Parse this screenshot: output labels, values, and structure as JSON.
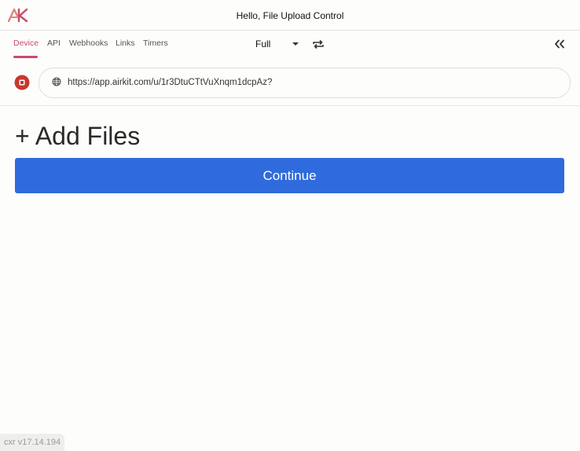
{
  "header": {
    "title": "Hello, File Upload Control",
    "logo_icon": "ak-logo-icon",
    "brand_colors": [
      "#d98a7a",
      "#c94a6e"
    ]
  },
  "toolbar": {
    "tabs": [
      {
        "label": "Device",
        "active": true
      },
      {
        "label": "API",
        "active": false
      },
      {
        "label": "Webhooks",
        "active": false
      },
      {
        "label": "Links",
        "active": false
      },
      {
        "label": "Timers",
        "active": false
      }
    ],
    "mode": "Full",
    "mode_caret_icon": "caret-down-icon",
    "repeat_icon": "repeat-icon",
    "collapse_icon": "double-chevron-left-icon",
    "active_color": "#c94a6e"
  },
  "address_bar": {
    "stop_icon": "stop-icon",
    "globe_icon": "globe-icon",
    "url": "https://app.airkit.com/u/1r3DtuCTtVuXnqm1dcpAz?"
  },
  "main": {
    "add_files_label": "+ Add Files",
    "continue_label": "Continue",
    "button_color": "#2f6bdc"
  },
  "footer": {
    "version": "cxr v17.14.194"
  }
}
